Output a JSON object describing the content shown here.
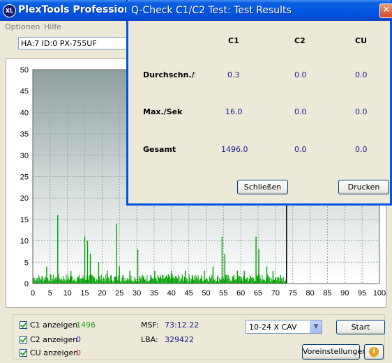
{
  "app": {
    "title": "PlexTools Professional XL",
    "logo": "XL"
  },
  "menu": [
    "Optionen",
    "Hilfe"
  ],
  "drive": {
    "selected": "HA:7 ID:0  PX-755UF"
  },
  "dialog": {
    "title": "Q-Check C1/C2 Test: Test Results",
    "headers": [
      "C1",
      "C2",
      "CU"
    ],
    "rows": [
      {
        "label": "Durchschn./S",
        "values": [
          "0.3",
          "0.0",
          "0.0"
        ]
      },
      {
        "label": "Max./Sek",
        "values": [
          "16.0",
          "0.0",
          "0.0"
        ]
      },
      {
        "label": "Gesamt",
        "values": [
          "1496.0",
          "0.0",
          "0.0"
        ]
      }
    ],
    "close_label": "Schließen",
    "print_label": "Drucken",
    "close_icon": "close-icon"
  },
  "chart_data": {
    "type": "bar",
    "xlim": [
      0,
      100
    ],
    "ylim": [
      0,
      50
    ],
    "x_ticks": [
      0,
      5,
      10,
      15,
      20,
      25,
      30,
      35,
      40,
      45,
      50,
      55,
      60,
      65,
      70,
      75,
      80,
      85,
      90,
      95,
      100
    ],
    "y_ticks": [
      0,
      5,
      10,
      15,
      20,
      25,
      30,
      35,
      40,
      45,
      50
    ],
    "grid": true,
    "end_marker_x": 73.2,
    "series": [
      {
        "color": "#00A000",
        "spikes": [
          {
            "x": 7.2,
            "y": 16
          },
          {
            "x": 15.0,
            "y": 11
          },
          {
            "x": 15.8,
            "y": 10
          },
          {
            "x": 16.6,
            "y": 7
          },
          {
            "x": 19.0,
            "y": 5
          },
          {
            "x": 24.2,
            "y": 14
          },
          {
            "x": 25.0,
            "y": 4
          },
          {
            "x": 30.3,
            "y": 8
          },
          {
            "x": 35.2,
            "y": 3
          },
          {
            "x": 40.0,
            "y": 3
          },
          {
            "x": 44.0,
            "y": 3
          },
          {
            "x": 49.5,
            "y": 3
          },
          {
            "x": 54.6,
            "y": 11
          },
          {
            "x": 55.4,
            "y": 7
          },
          {
            "x": 59.0,
            "y": 3
          },
          {
            "x": 64.4,
            "y": 11
          },
          {
            "x": 65.2,
            "y": 8
          },
          {
            "x": 69.3,
            "y": 3
          },
          {
            "x": 4.0,
            "y": 4
          },
          {
            "x": 11.0,
            "y": 3
          },
          {
            "x": 21.5,
            "y": 3
          },
          {
            "x": 28.0,
            "y": 3
          },
          {
            "x": 34.0,
            "y": 2
          },
          {
            "x": 46.0,
            "y": 2
          },
          {
            "x": 52.0,
            "y": 4
          },
          {
            "x": 58.0,
            "y": 2
          },
          {
            "x": 61.0,
            "y": 3
          },
          {
            "x": 67.5,
            "y": 4
          },
          {
            "x": 71.5,
            "y": 2
          }
        ]
      }
    ]
  },
  "controls": {
    "show_c1": "C1 anzeigen",
    "c1_count": "1496",
    "show_c2": "C2 anzeigen",
    "c2_count": "0",
    "show_cu": "CU anzeigen",
    "cu_count": "0",
    "msf_label": "MSF:",
    "msf_value": "73:12.22",
    "lba_label": "LBA:",
    "lba_value": "329422",
    "speed": "10-24 X CAV",
    "start_label": "Start",
    "settings_label": "Voreinstellungen",
    "info_icon": "info-icon",
    "colors": {
      "c1": "#21A121",
      "c2": "#2020C0",
      "cu": "#D02020"
    }
  }
}
